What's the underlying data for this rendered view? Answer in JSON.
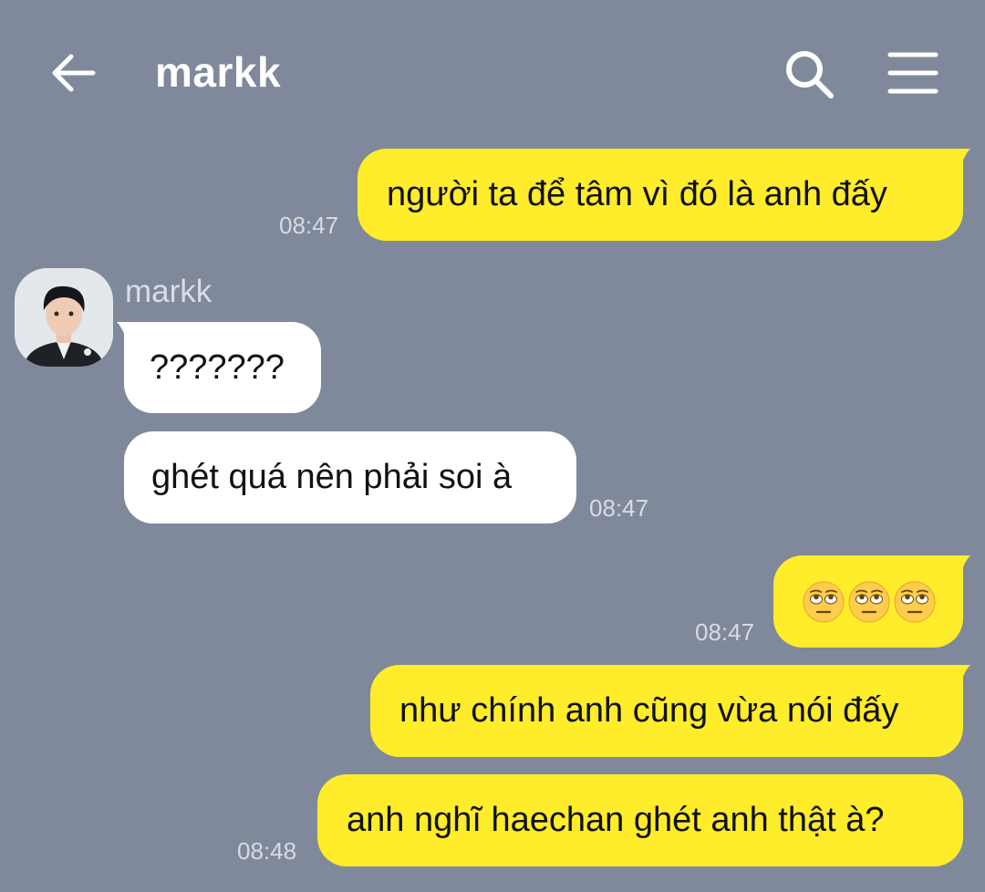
{
  "header": {
    "title": "markk"
  },
  "icons": {
    "back": "arrow-left-icon",
    "search": "search-icon",
    "menu": "hamburger-menu-icon"
  },
  "colors": {
    "background": "#7f899b",
    "outgoing_bubble": "#ffec2b",
    "incoming_bubble": "#ffffff"
  },
  "contact": {
    "name": "markk"
  },
  "messages": [
    {
      "direction": "out",
      "text": "người ta để tâm vì đó là anh đấy",
      "time": "08:47"
    },
    {
      "direction": "in",
      "text": "???????"
    },
    {
      "direction": "in",
      "text": "ghét quá nên phải soi à",
      "time": "08:47"
    },
    {
      "direction": "out",
      "emoji": [
        "face-with-rolling-eyes",
        "face-with-rolling-eyes",
        "face-with-rolling-eyes"
      ],
      "time": "08:47"
    },
    {
      "direction": "out",
      "text": "như chính anh cũng vừa nói đấy"
    },
    {
      "direction": "out",
      "text": "anh nghĩ haechan ghét anh thật à?",
      "time": "08:48"
    }
  ]
}
